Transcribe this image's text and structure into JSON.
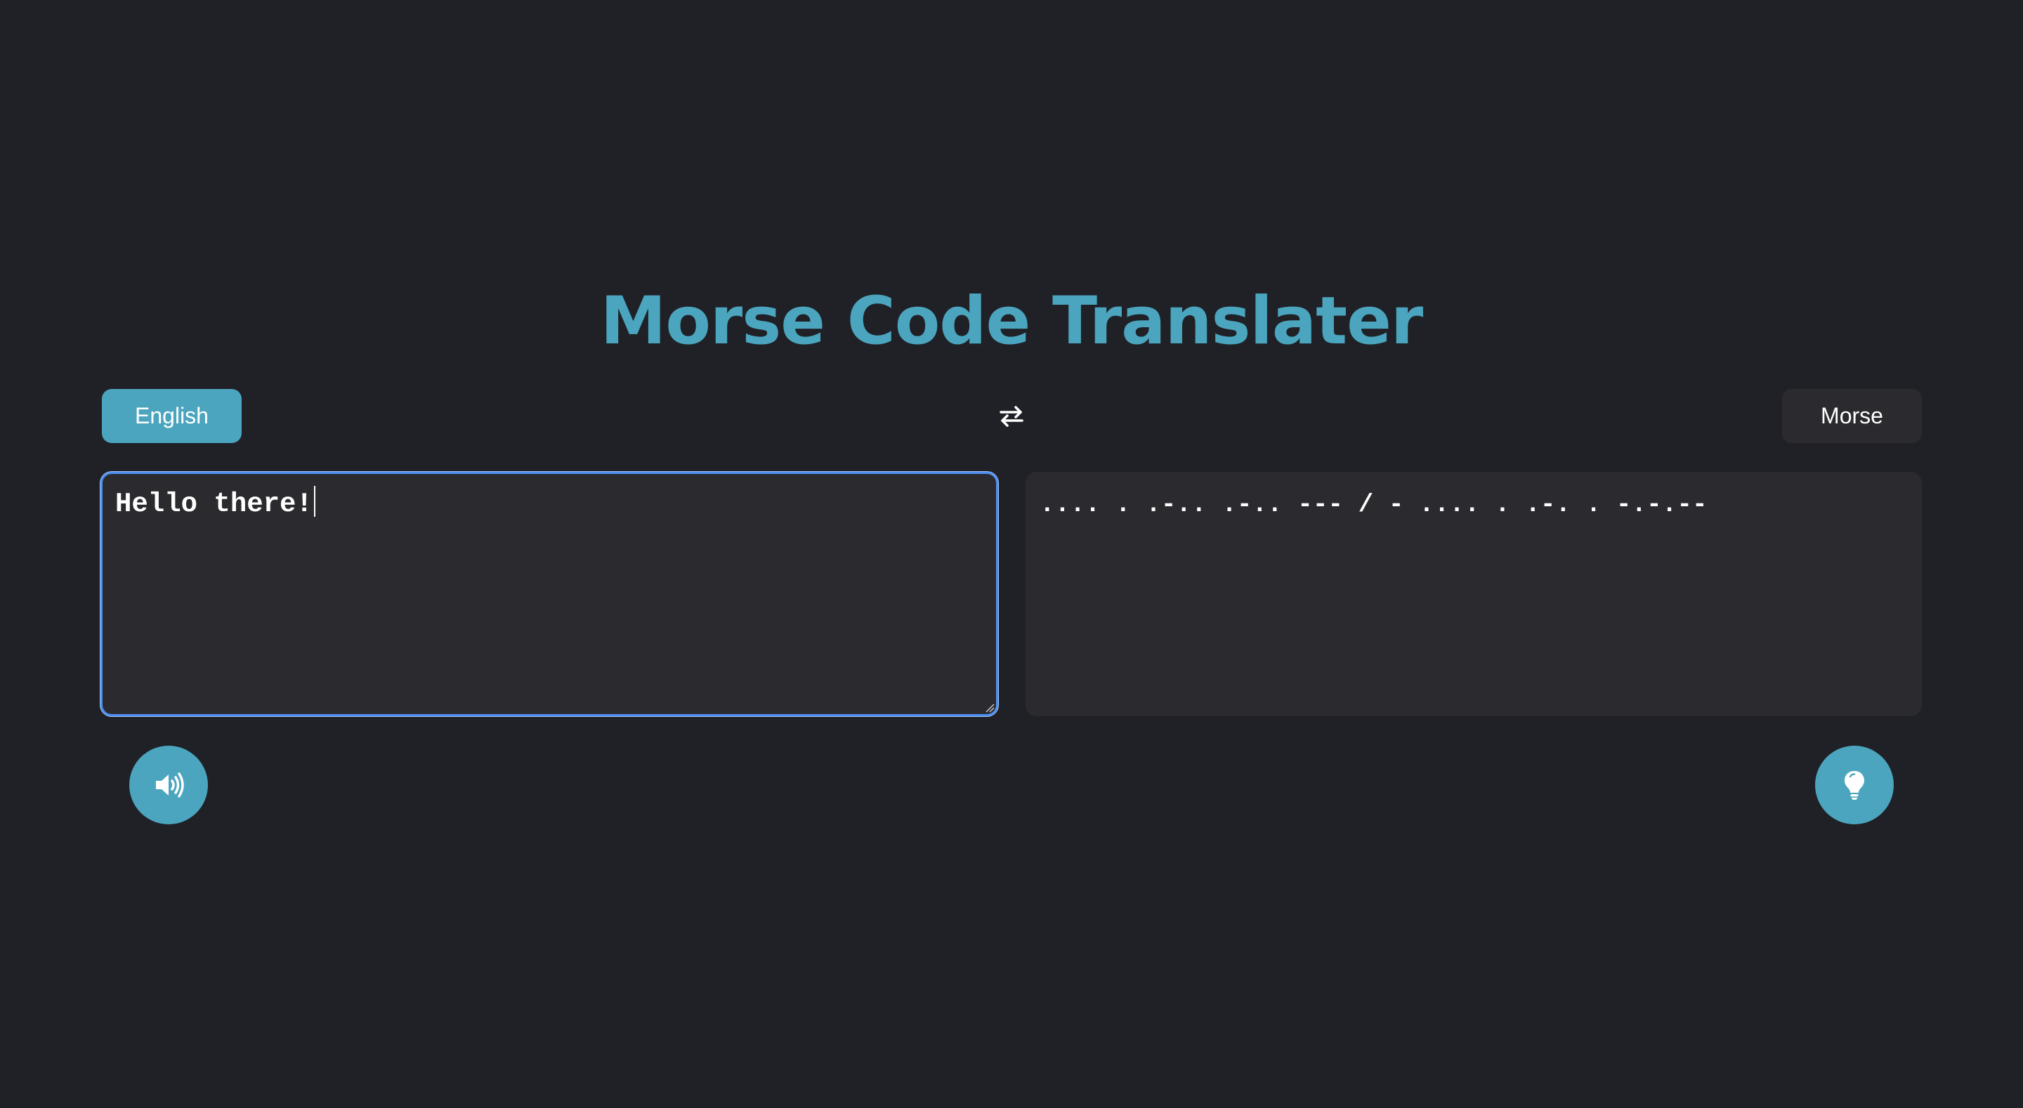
{
  "app": {
    "title": "Morse Code Translater"
  },
  "languages": {
    "source_label": "English",
    "target_label": "Morse"
  },
  "icons": {
    "swap": "swap-arrows-icon",
    "speak": "speaker-icon",
    "hint": "lightbulb-icon"
  },
  "input": {
    "value": "Hello there!"
  },
  "output": {
    "value": ".... . .-.. .-.. --- / - .... . .-. . -.-.--"
  },
  "colors": {
    "accent": "#4ba5bf",
    "background": "#202127",
    "panel": "#2b2b2f",
    "focus_border": "#4e8ff0"
  }
}
